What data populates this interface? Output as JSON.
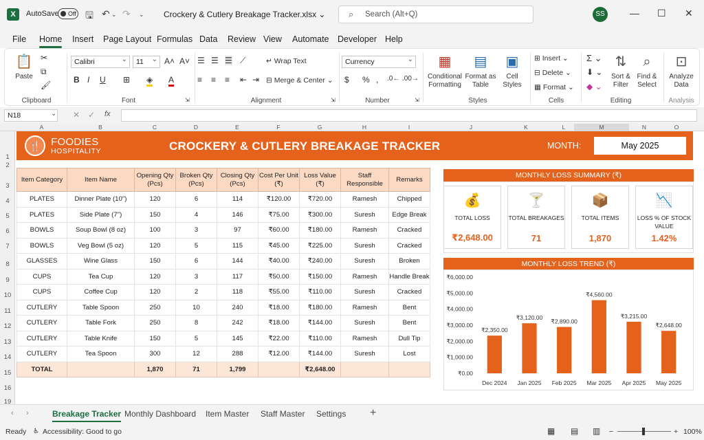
{
  "titlebar": {
    "app_logo": "X",
    "autosave_label": "AutoSave",
    "autosave_state": "Off",
    "doc_title": "Crockery & Cutlery Breakage Tracker.xlsx",
    "search_placeholder": "Search (Alt+Q)",
    "user_initials": "SS"
  },
  "menu": [
    "File",
    "Home",
    "Insert",
    "Page Layout",
    "Formulas",
    "Data",
    "Review",
    "View",
    "Automate",
    "Developer",
    "Help"
  ],
  "ribbon": {
    "paste": "Paste",
    "font_name": "Calibri",
    "font_size": "11",
    "wrap_text": "Wrap Text",
    "merge_center": "Merge & Center",
    "number_format": "Currency",
    "conditional_formatting": "Conditional Formatting",
    "format_as_table": "Format as Table",
    "cell_styles": "Cell Styles",
    "insert": "Insert",
    "delete": "Delete",
    "format": "Format",
    "sort_filter": "Sort & Filter",
    "find_select": "Find & Select",
    "analyze_data": "Analyze Data",
    "groups": [
      "Clipboard",
      "Font",
      "Alignment",
      "Number",
      "Styles",
      "Cells",
      "Editing",
      "Analysis"
    ]
  },
  "formula_bar": {
    "name_box": "N18",
    "fx": "fx"
  },
  "columns": [
    "A",
    "B",
    "C",
    "D",
    "E",
    "F",
    "G",
    "H",
    "I",
    "J",
    "K",
    "L",
    "M",
    "N",
    "O"
  ],
  "rows": [
    "1",
    "2",
    "3",
    "4",
    "5",
    "6",
    "7",
    "8",
    "9",
    "10",
    "11",
    "12",
    "13",
    "14",
    "15",
    "16",
    "17",
    "18",
    "19"
  ],
  "banner": {
    "brand_line1": "FOODIES",
    "brand_line2": "HOSPITALITY",
    "title": "CROCKERY & CUTLERY BREAKAGE TRACKER",
    "month_label": "MONTH:",
    "month_value": "May 2025"
  },
  "table": {
    "headers": [
      "Item Category",
      "Item Name",
      "Opening Qty (Pcs)",
      "Broken Qty (Pcs)",
      "Closing Qty (Pcs)",
      "Cost Per Unit (₹)",
      "Loss Value (₹)",
      "Staff Responsible",
      "Remarks"
    ],
    "rows": [
      [
        "PLATES",
        "Dinner Plate (10\")",
        "120",
        "6",
        "114",
        "₹120.00",
        "₹720.00",
        "Ramesh",
        "Chipped"
      ],
      [
        "PLATES",
        "Side Plate (7\")",
        "150",
        "4",
        "146",
        "₹75.00",
        "₹300.00",
        "Suresh",
        "Edge Break"
      ],
      [
        "BOWLS",
        "Soup Bowl (8 oz)",
        "100",
        "3",
        "97",
        "₹60.00",
        "₹180.00",
        "Ramesh",
        "Cracked"
      ],
      [
        "BOWLS",
        "Veg Bowl (5 oz)",
        "120",
        "5",
        "115",
        "₹45.00",
        "₹225.00",
        "Suresh",
        "Cracked"
      ],
      [
        "GLASSES",
        "Wine Glass",
        "150",
        "6",
        "144",
        "₹40.00",
        "₹240.00",
        "Suresh",
        "Broken"
      ],
      [
        "CUPS",
        "Tea Cup",
        "120",
        "3",
        "117",
        "₹50.00",
        "₹150.00",
        "Ramesh",
        "Handle Break"
      ],
      [
        "CUPS",
        "Coffee Cup",
        "120",
        "2",
        "118",
        "₹55.00",
        "₹110.00",
        "Suresh",
        "Cracked"
      ],
      [
        "CUTLERY",
        "Table Spoon",
        "250",
        "10",
        "240",
        "₹18.00",
        "₹180.00",
        "Ramesh",
        "Bent"
      ],
      [
        "CUTLERY",
        "Table Fork",
        "250",
        "8",
        "242",
        "₹18.00",
        "₹144.00",
        "Suresh",
        "Bent"
      ],
      [
        "CUTLERY",
        "Table Knife",
        "150",
        "5",
        "145",
        "₹22.00",
        "₹110.00",
        "Ramesh",
        "Dull Tip"
      ],
      [
        "CUTLERY",
        "Tea Spoon",
        "300",
        "12",
        "288",
        "₹12.00",
        "₹144.00",
        "Suresh",
        "Lost"
      ]
    ],
    "total": [
      "TOTAL",
      "",
      "1,870",
      "71",
      "1,799",
      "",
      "₹2,648.00",
      "",
      ""
    ]
  },
  "summary": {
    "title": "MONTHLY LOSS SUMMARY (₹)",
    "cards": [
      {
        "label": "TOTAL LOSS",
        "value": "₹2,648.00",
        "icon": "money-bag-icon"
      },
      {
        "label": "TOTAL BREAKAGES",
        "value": "71",
        "icon": "broken-glass-icon"
      },
      {
        "label": "TOTAL ITEMS",
        "value": "1,870",
        "icon": "box-icon"
      },
      {
        "label": "LOSS % OF STOCK VALUE",
        "value": "1.42%",
        "icon": "trend-down-icon"
      }
    ]
  },
  "trend": {
    "title": "MONTHLY LOSS TREND (₹)",
    "bar_color": "#e5621d"
  },
  "chart_data": {
    "type": "bar",
    "categories": [
      "Dec 2024",
      "Jan 2025",
      "Feb 2025",
      "Mar 2025",
      "Apr 2025",
      "May 2025"
    ],
    "values": [
      2350,
      3120,
      2890,
      4560,
      3215,
      2648
    ],
    "data_labels": [
      "₹2,350.00",
      "₹3,120.00",
      "₹2,890.00",
      "₹4,560.00",
      "₹3,215.00",
      "₹2,648.00"
    ],
    "yticks": [
      "₹0.00",
      "₹1,000.00",
      "₹2,000.00",
      "₹3,000.00",
      "₹4,000.00",
      "₹5,000.00",
      "₹6,000.00"
    ],
    "ylim": [
      0,
      6000
    ],
    "title": "MONTHLY LOSS TREND (₹)",
    "xlabel": "",
    "ylabel": "",
    "grid": false
  },
  "sheet_tabs": [
    "Breakage Tracker",
    "Monthly Dashboard",
    "Item Master",
    "Staff Master",
    "Settings"
  ],
  "status": {
    "ready": "Ready",
    "accessibility": "Accessibility: Good to go",
    "zoom": "100%"
  },
  "colors": {
    "accent": "#e5621d",
    "excel_green": "#1d6f42",
    "header_fill": "#fbd9c3"
  }
}
